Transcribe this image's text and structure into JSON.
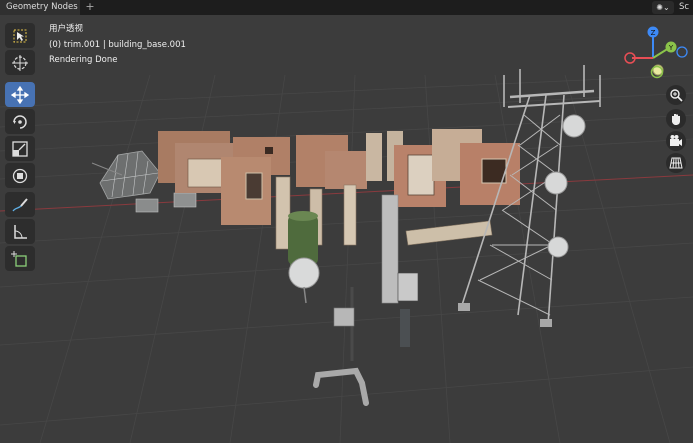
{
  "topbar": {
    "workspace_tab": "Geometry Nodes",
    "add_tab": "+",
    "scene_label": "Sc"
  },
  "viewport": {
    "view_name": "用户透视",
    "object_info": "(0) trim.001 | building_base.001",
    "status": "Rendering Done"
  },
  "toolbar": {
    "tools": [
      {
        "name": "select-box-tool",
        "icon": "select-box-icon",
        "active": false
      },
      {
        "name": "cursor-tool",
        "icon": "cursor-icon",
        "active": false
      },
      {
        "name": "move-tool",
        "icon": "move-icon",
        "active": true
      },
      {
        "name": "rotate-tool",
        "icon": "rotate-icon",
        "active": false
      },
      {
        "name": "scale-tool",
        "icon": "scale-icon",
        "active": false
      },
      {
        "name": "transform-tool",
        "icon": "transform-icon",
        "active": false
      },
      {
        "name": "annotate-tool",
        "icon": "annotate-icon",
        "active": false
      },
      {
        "name": "measure-tool",
        "icon": "measure-icon",
        "active": false
      },
      {
        "name": "add-cube-tool",
        "icon": "add-cube-icon",
        "active": false
      }
    ]
  },
  "gizmo": {
    "axis_x_label": "X",
    "axis_y_label": "Y",
    "axis_z_label": "Z",
    "colors": {
      "x": "#e84e55",
      "y": "#8bc34a",
      "z": "#3d8af7"
    }
  },
  "nav_buttons": [
    "zoom-icon",
    "hand-pan-icon",
    "camera-icon",
    "grid-view-icon"
  ],
  "colors": {
    "accent": "#4772b3",
    "viewport_bg": "#3c3c3c",
    "header_bg": "#1d1d1d"
  }
}
